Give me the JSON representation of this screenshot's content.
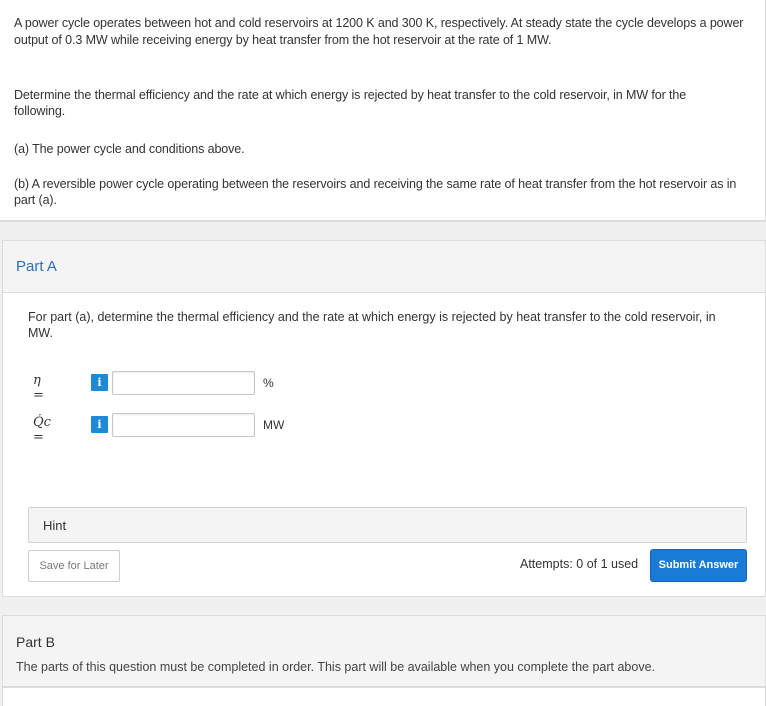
{
  "question": {
    "intro_line1": "A power cycle operates between hot and cold reservoirs at 1200 K and 300 K, respectively. At steady state the cycle develops a power",
    "intro_line2": "output of 0.3 MW while receiving energy by heat transfer from the hot reservoir at the rate of 1 MW.",
    "determine_line1": "Determine the thermal efficiency and the rate at which energy is rejected by heat transfer to the cold reservoir, in MW for the",
    "determine_line2": "following.",
    "item_a": "(a) The power cycle and conditions above.",
    "item_b_line1": "(b) A reversible power cycle operating between the reservoirs and receiving the same rate of heat transfer from the hot reservoir as in",
    "item_b_line2": "part (a)."
  },
  "partA": {
    "title": "Part A",
    "prompt": "For part (a), determine the thermal efficiency and the rate at which energy is rejected by heat transfer to the cold reservoir, in MW.",
    "answers": [
      {
        "label": "η =",
        "info": "i",
        "value": "",
        "unit": "%"
      },
      {
        "label": "Q̇c =",
        "info": "i",
        "value": "",
        "unit": "MW"
      }
    ],
    "hint_label": "Hint",
    "save_label": "Save for Later",
    "attempts_text": "Attempts: 0 of 1 used",
    "submit_label": "Submit Answer"
  },
  "partB": {
    "title": "Part B",
    "message": "The parts of this question must be completed in order. This part will be available when you complete the part above."
  },
  "colors": {
    "accent": "#1a7bd6",
    "title_blue": "#2a71b8",
    "info_blue": "#1e8ad6"
  }
}
